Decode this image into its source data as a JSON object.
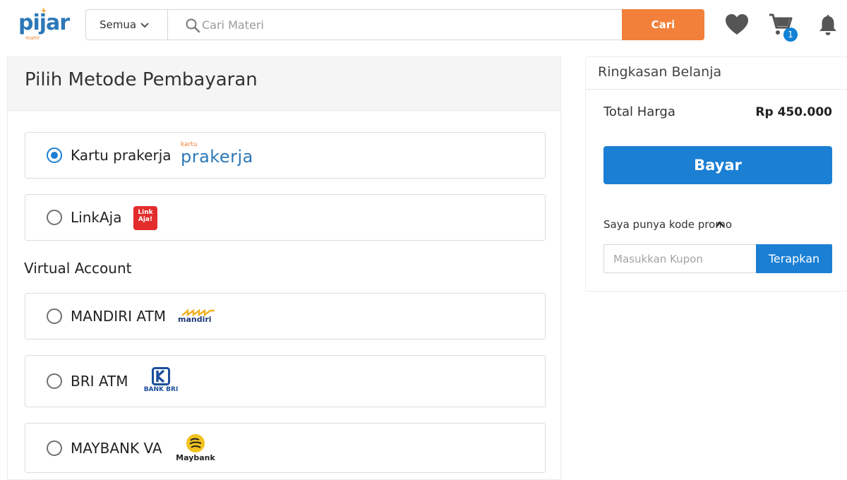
{
  "header": {
    "logo": {
      "text": "pijar",
      "sub": "mahir"
    },
    "category_select": {
      "value": "Semua"
    },
    "search": {
      "placeholder": "Cari Materi",
      "button_label": "Cari"
    },
    "cart_count": "1",
    "icons": [
      "heart-icon",
      "cart-icon",
      "bell-icon",
      "search-icon",
      "chevron-down-icon"
    ]
  },
  "payment": {
    "title": "Pilih Metode Pembayaran",
    "section_label": "Virtual Account",
    "methods": [
      {
        "label": "Kartu prakerja",
        "selected": true,
        "logo_text": "prakerja",
        "logo_sub": "kartu"
      },
      {
        "label": "LinkAja",
        "selected": false,
        "logo_text": "Link Aja!"
      },
      {
        "label": "MANDIRI ATM",
        "selected": false,
        "logo_text": "mandiri"
      },
      {
        "label": "BRI ATM",
        "selected": false,
        "logo_text": "BANK BRI"
      },
      {
        "label": "MAYBANK VA",
        "selected": false,
        "logo_text": "Maybank"
      }
    ]
  },
  "summary": {
    "title": "Ringkasan Belanja",
    "total_label": "Total Harga",
    "total_value": "Rp 450.000",
    "pay_label": "Bayar",
    "promo_toggle": "Saya punya kode promo",
    "coupon_placeholder": "Masukkan Kupon",
    "apply_label": "Terapkan"
  },
  "colors": {
    "brand_blue": "#1b7fd4",
    "search_orange": "#f2803a",
    "logo_blue": "#2c78b9",
    "linkaja_red": "#e32c2c"
  }
}
